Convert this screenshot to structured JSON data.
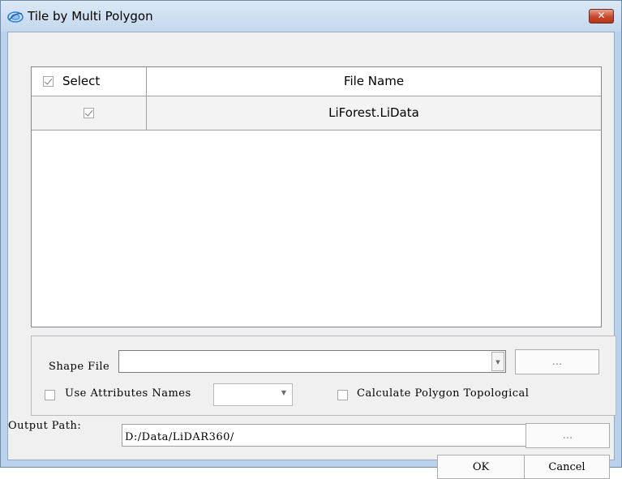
{
  "window": {
    "title": "Tile by Multi Polygon",
    "close_label": "✕"
  },
  "table": {
    "columns": [
      "Select",
      "File Name"
    ],
    "header_select_checked": true,
    "rows": [
      {
        "checked": true,
        "file_name": "LiForest.LiData"
      }
    ]
  },
  "shape": {
    "label": "Shape File",
    "value": "",
    "browse_label": "...",
    "use_attributes_label": "Use Attributes Names",
    "use_attributes_checked": false,
    "attribute_value": "",
    "calc_topology_label": "Calculate Polygon Topological",
    "calc_topology_checked": false
  },
  "output": {
    "label": "Output Path:",
    "value": "D:/Data/LiDAR360/",
    "browse_label": "..."
  },
  "buttons": {
    "ok": "OK",
    "cancel": "Cancel"
  }
}
